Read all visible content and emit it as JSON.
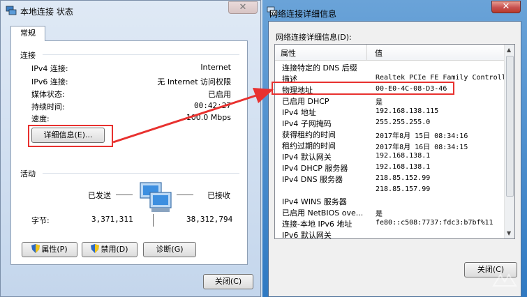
{
  "status_window": {
    "title": "本地连接 状态",
    "tab": "常规",
    "connection_section": "连接",
    "rows": [
      {
        "label": "IPv4 连接:",
        "value": "Internet"
      },
      {
        "label": "IPv6 连接:",
        "value": "无 Internet 访问权限"
      },
      {
        "label": "媒体状态:",
        "value": "已启用"
      },
      {
        "label": "持续时间:",
        "value": "00:42:27"
      },
      {
        "label": "速度:",
        "value": "100.0 Mbps"
      }
    ],
    "details_button": "详细信息(E)...",
    "activity_section": "活动",
    "sent_label": "已发送",
    "received_label": "已接收",
    "bytes_label": "字节:",
    "bytes_sent": "3,371,311",
    "bytes_received": "38,312,794",
    "properties_button": "属性(P)",
    "disable_button": "禁用(D)",
    "diagnose_button": "诊断(G)",
    "close_button": "关闭(C)"
  },
  "details_window": {
    "title": "网络连接详细信息",
    "list_label": "网络连接详细信息(D):",
    "col_property": "属性",
    "col_value": "值",
    "rows": [
      {
        "prop": "连接特定的 DNS 后缀",
        "value": ""
      },
      {
        "prop": "描述",
        "value": "Realtek PCIe FE Family Controller"
      },
      {
        "prop": "物理地址",
        "value": "00-E0-4C-08-D3-46"
      },
      {
        "prop": "已启用 DHCP",
        "value": "是"
      },
      {
        "prop": "IPv4 地址",
        "value": "192.168.138.115"
      },
      {
        "prop": "IPv4 子网掩码",
        "value": "255.255.255.0"
      },
      {
        "prop": "获得租约的时间",
        "value": "2017年8月 15日 08:34:16"
      },
      {
        "prop": "租约过期的时间",
        "value": "2017年8月 16日 08:34:15"
      },
      {
        "prop": "IPv4 默认网关",
        "value": "192.168.138.1"
      },
      {
        "prop": "IPv4 DHCP 服务器",
        "value": "192.168.138.1"
      },
      {
        "prop": "IPv4 DNS 服务器",
        "value": "218.85.152.99"
      },
      {
        "prop": "",
        "value": "218.85.157.99"
      },
      {
        "prop": "IPv4 WINS 服务器",
        "value": ""
      },
      {
        "prop": "已启用 NetBIOS ove...",
        "value": "是"
      },
      {
        "prop": "连接-本地 IPv6 地址",
        "value": "fe80::c508:7737:fdc3:b7bf%11"
      },
      {
        "prop": "IPv6 默认网关",
        "value": ""
      }
    ],
    "close_button": "关闭(C)"
  },
  "colors": {
    "highlight": "#e8312f",
    "titlebar": "#2f79c2"
  }
}
